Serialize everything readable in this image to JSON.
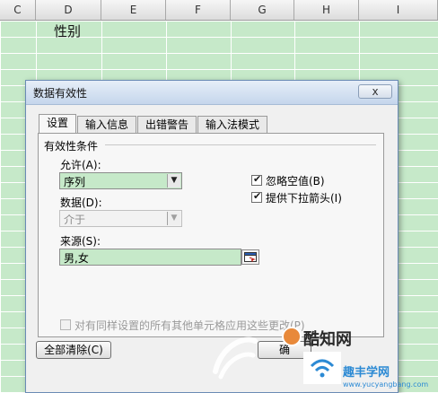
{
  "sheet": {
    "columns": [
      "C",
      "D",
      "E",
      "F",
      "G",
      "H",
      "I"
    ],
    "cell_d1": "性别"
  },
  "dialog": {
    "title": "数据有效性",
    "close_label": "x",
    "tabs": [
      {
        "label": "设置",
        "active": true
      },
      {
        "label": "输入信息",
        "active": false
      },
      {
        "label": "出错警告",
        "active": false
      },
      {
        "label": "输入法模式",
        "active": false
      }
    ],
    "group_label": "有效性条件",
    "allow_label": "允许(A):",
    "allow_value": "序列",
    "data_label": "数据(D):",
    "data_value": "介于",
    "source_label": "来源(S):",
    "source_value": "男,女",
    "ignore_blank": {
      "label": "忽略空值(B)",
      "checked": true
    },
    "dropdown": {
      "label": "提供下拉箭头(I)",
      "checked": true
    },
    "apply_all": {
      "label": "对有同样设置的所有其他单元格应用这些更改(P)",
      "checked": false
    },
    "clear_all_label": "全部清除(C)",
    "ok_label": "确"
  },
  "watermark": {
    "brand": "酷知网",
    "sub": "趣丰学网",
    "url": "www.yucyangbang.com"
  },
  "colors": {
    "sheet_bg": "#c6e9c9",
    "dialog_bg": "#f0f0f0",
    "watermark_orange": "#e8893a"
  }
}
